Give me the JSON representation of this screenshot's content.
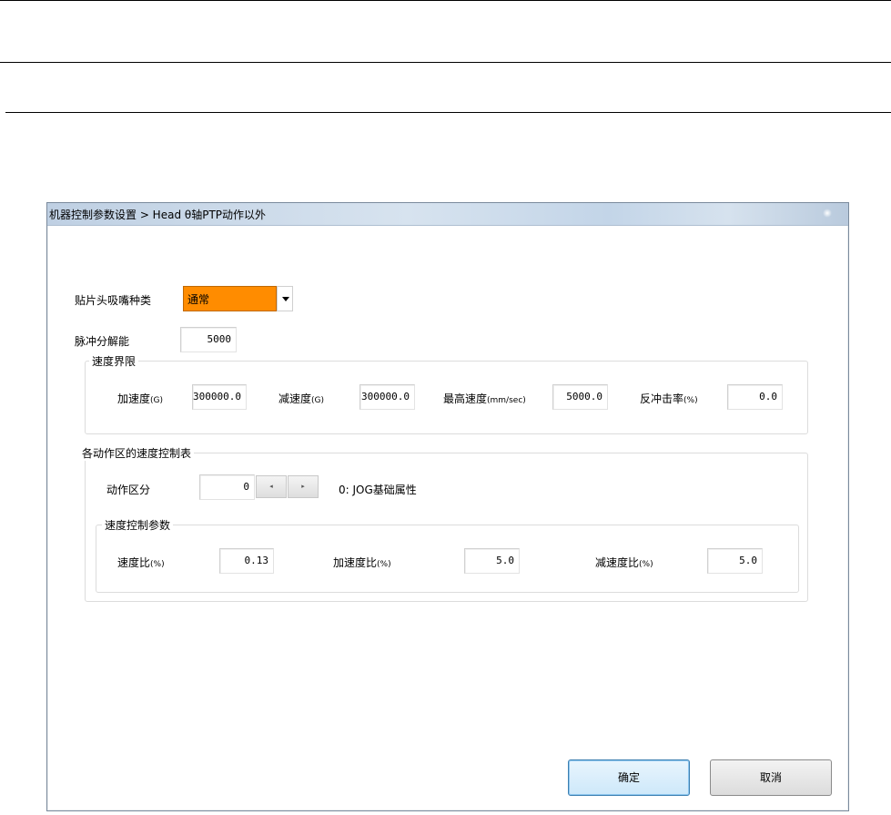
{
  "window": {
    "title": "机器控制参数设置 > Head θ轴PTP动作以外"
  },
  "nozzle": {
    "label": "贴片头吸嘴种类",
    "selected": "通常"
  },
  "pulse": {
    "label": "脉冲分解能",
    "value": "5000"
  },
  "speed_limit": {
    "legend": "速度界限",
    "accel_label": "加速度",
    "accel_unit": "(G)",
    "accel_value": "300000.0",
    "decel_label": "减速度",
    "decel_unit": "(G)",
    "decel_value": "300000.0",
    "max_speed_label": "最高速度",
    "max_speed_unit": "(mm/sec)",
    "max_speed_value": "5000.0",
    "backlash_label": "反冲击率",
    "backlash_unit": "(%)",
    "backlash_value": "0.0"
  },
  "speed_table": {
    "legend": "各动作区的速度控制表",
    "zone_label": "动作区分",
    "zone_value": "0",
    "zone_prev_icon": "◂",
    "zone_next_icon": "▸",
    "zone_description": "0: JOG基础属性",
    "params": {
      "legend": "速度控制参数",
      "speed_ratio_label": "速度比",
      "speed_ratio_unit": "(%)",
      "speed_ratio_value": "0.13",
      "accel_ratio_label": "加速度比",
      "accel_ratio_unit": "(%)",
      "accel_ratio_value": "5.0",
      "decel_ratio_label": "减速度比",
      "decel_ratio_unit": "(%)",
      "decel_ratio_value": "5.0"
    }
  },
  "buttons": {
    "ok": "确定",
    "cancel": "取消"
  },
  "colors": {
    "combo_selected_bg": "#ff8c00",
    "ok_border": "#3c7fb1"
  }
}
